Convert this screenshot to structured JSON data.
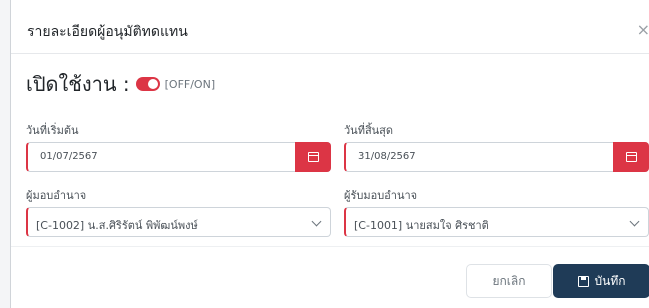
{
  "dialog": {
    "title": "รายละเอียดผู้อนุมัติทดแทน",
    "close_icon": "close-icon",
    "close_glyph": "×"
  },
  "enable": {
    "label": "เปิดใช้งาน :",
    "state": "on",
    "toggle_text": "[OFF/ON]",
    "color": "#dc3545"
  },
  "fields": {
    "start_date": {
      "label": "วันที่เริ่มต้น",
      "value": "01/07/2567",
      "icon": "calendar-icon"
    },
    "end_date": {
      "label": "วันที่สิ้นสุด",
      "value": "31/08/2567",
      "icon": "calendar-icon"
    },
    "delegator": {
      "label": "ผู้มอบอำนาจ",
      "value": "[C-1002] น.ส.ศิริรัตน์ พิพัฒน์พงษ์",
      "icon": "chevron-down-icon"
    },
    "delegate": {
      "label": "ผู้รับมอบอำนาจ",
      "value": "[C-1001] นายสมใจ ศิรชาติ",
      "icon": "chevron-down-icon"
    }
  },
  "footer": {
    "cancel_label": "ยกเลิก",
    "save_label": "บันทึก",
    "save_icon": "save-icon",
    "primary_color": "#1f3b57"
  }
}
